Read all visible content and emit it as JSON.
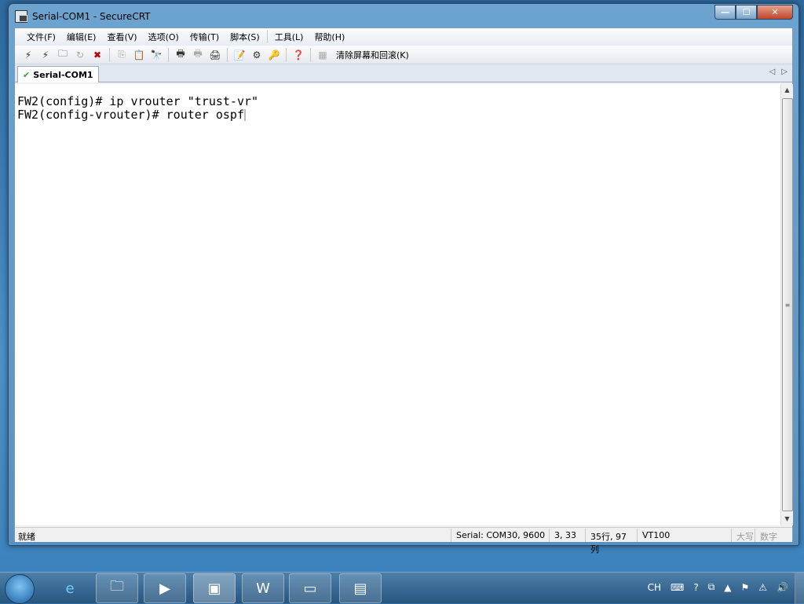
{
  "window": {
    "title": "Serial-COM1 - SecureCRT",
    "min": "—",
    "max": "☐",
    "close": "✕"
  },
  "menu": [
    "文件(F)",
    "编辑(E)",
    "查看(V)",
    "选项(O)",
    "传输(T)",
    "脚本(S)",
    "工具(L)",
    "帮助(H)"
  ],
  "toolbar": {
    "clear_label": "清除屏幕和回滚(K)"
  },
  "tab": {
    "label": "Serial-COM1",
    "prev": "◁",
    "next": "▷"
  },
  "terminal": {
    "lines": [
      "FW2(config)# ip vrouter \"trust-vr\"",
      "FW2(config-vrouter)# router ospf"
    ]
  },
  "status": {
    "left": "就绪",
    "connection": "Serial: COM30, 9600",
    "cursor": "3,  33",
    "size": "35行, 97列",
    "emulation": "VT100",
    "caps": "大写",
    "num": "数字"
  },
  "tray": {
    "lang": "CH"
  }
}
